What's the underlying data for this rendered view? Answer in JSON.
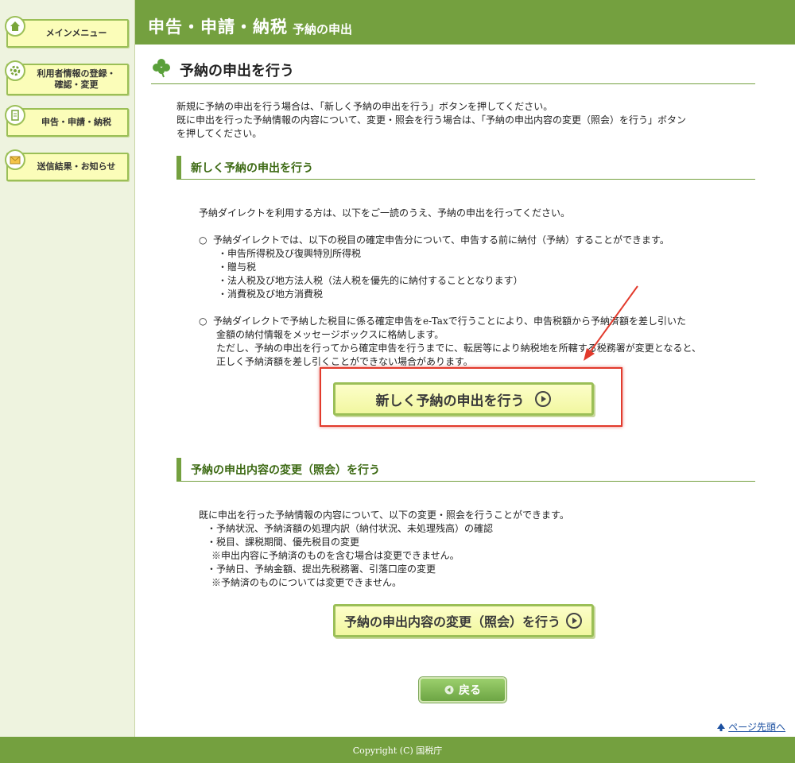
{
  "sidebar": {
    "items": [
      {
        "label": "メインメニュー",
        "icon": "home-icon"
      },
      {
        "label1": "利用者情報の登録・",
        "label2": "確認・変更",
        "icon": "settings-icon"
      },
      {
        "label": "申告・申請・納税",
        "icon": "document-icon"
      },
      {
        "label": "送信結果・お知らせ",
        "icon": "mail-icon"
      }
    ]
  },
  "header": {
    "title": "申告・申請・納税",
    "subtitle": "予納の申出"
  },
  "page": {
    "title": "予納の申出を行う",
    "intro1": "新規に予納の申出を行う場合は、「新しく予納の申出を行う」ボタンを押してください。",
    "intro2": "既に申出を行った予納情報の内容について、変更・照会を行う場合は、「予納の申出内容の変更（照会）を行う」ボタン",
    "intro3": "を押してください。"
  },
  "section1": {
    "heading": "新しく予納の申出を行う",
    "lead": "予納ダイレクトを利用する方は、以下をご一読のうえ、予納の申出を行ってください。",
    "bullet1": "○",
    "item1": "予納ダイレクトでは、以下の税目の確定申告分について、申告する前に納付（予納）することができます。",
    "sub1": "・申告所得税及び復興特別所得税",
    "sub2": "・贈与税",
    "sub3": "・法人税及び地方法人税（法人税を優先的に納付することとなります）",
    "sub4": "・消費税及び地方消費税",
    "bullet2": "○",
    "item2a": "予納ダイレクトで予納した税目に係る確定申告をe-Taxで行うことにより、申告税額から予納済額を差し引いた",
    "item2b": "金額の納付情報をメッセージボックスに格納します。",
    "item2c": "ただし、予納の申出を行ってから確定申告を行うまでに、転居等により納税地を所轄する税務署が変更となると、",
    "item2d": "正しく予納済額を差し引くことができない場合があります。",
    "button": "新しく予納の申出を行う"
  },
  "section2": {
    "heading": "予納の申出内容の変更（照会）を行う",
    "lead": "既に申出を行った予納情報の内容について、以下の変更・照会を行うことができます。",
    "l1": "・予納状況、予納済額の処理内訳（納付状況、未処理残高）の確認",
    "l2": "・税目、課税期間、優先税目の変更",
    "l3": "※申出内容に予納済のものを含む場合は変更できません。",
    "l4": "・予納日、予納金額、提出先税務署、引落口座の変更",
    "l5": "※予納済のものについては変更できません。",
    "button": "予納の申出内容の変更（照会）を行う"
  },
  "back_button": "戻る",
  "page_top_link": "ページ先頭へ",
  "footer": "Copyright (C) 国税庁",
  "colors": {
    "header": "#74a03f",
    "button_bg": "#f5f9a8",
    "highlight": "#e23a2c"
  }
}
